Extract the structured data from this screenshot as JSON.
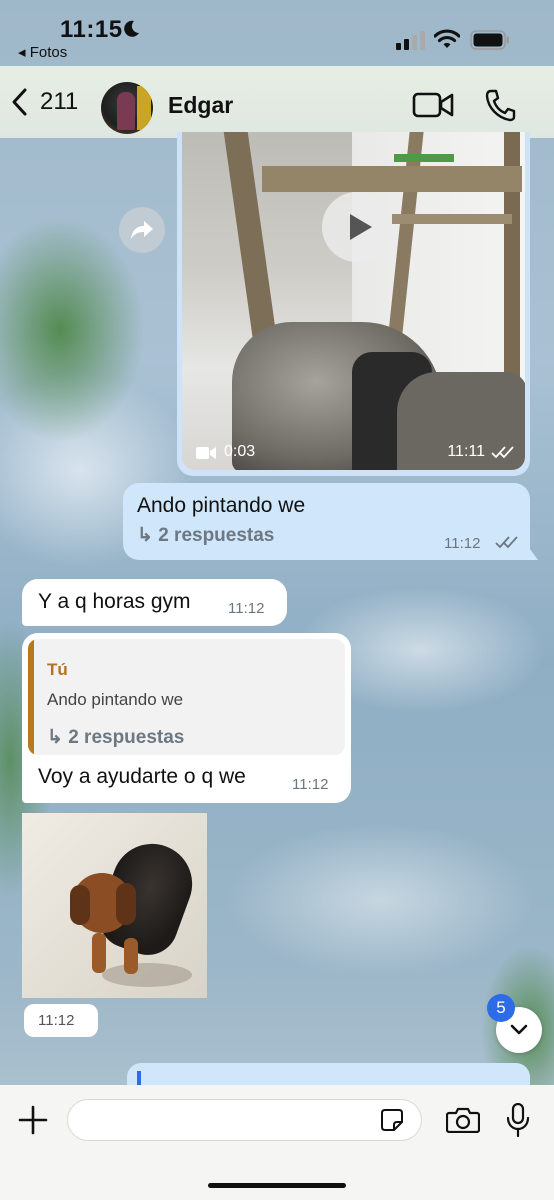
{
  "status_bar": {
    "time": "11:15",
    "back_app": "◂ Fotos",
    "icons": [
      "moon-icon",
      "signal-icon",
      "wifi-icon",
      "battery-icon"
    ]
  },
  "header": {
    "back_count": "211",
    "contact_name": "Edgar",
    "actions": [
      "video-call-icon",
      "phone-icon"
    ]
  },
  "messages": {
    "video": {
      "duration": "0:03",
      "time": "11:11",
      "status": "read"
    },
    "outgoing_text": {
      "text": "Ando pintando we",
      "replies": "↳ 2 respuestas",
      "time": "11:12",
      "status": "read"
    },
    "incoming_1": {
      "text": "Y a q horas gym",
      "time": "11:12"
    },
    "incoming_2": {
      "quote_author": "Tú",
      "quote_text": "Ando pintando we",
      "quote_replies": "↳ 2 respuestas",
      "text": "Voy a ayudarte o q we",
      "time": "11:12"
    },
    "photo": {
      "time": "11:12"
    }
  },
  "scroll_down": {
    "unread_badge": "5"
  },
  "composer": {
    "placeholder": "",
    "icons": [
      "plus-icon",
      "sticker-icon",
      "camera-icon",
      "microphone-icon"
    ]
  },
  "colors": {
    "outgoing_bubble": "#d0e6fb",
    "incoming_bubble": "#ffffff",
    "quote_accent": "#b9781c",
    "badge": "#2e6be6"
  }
}
